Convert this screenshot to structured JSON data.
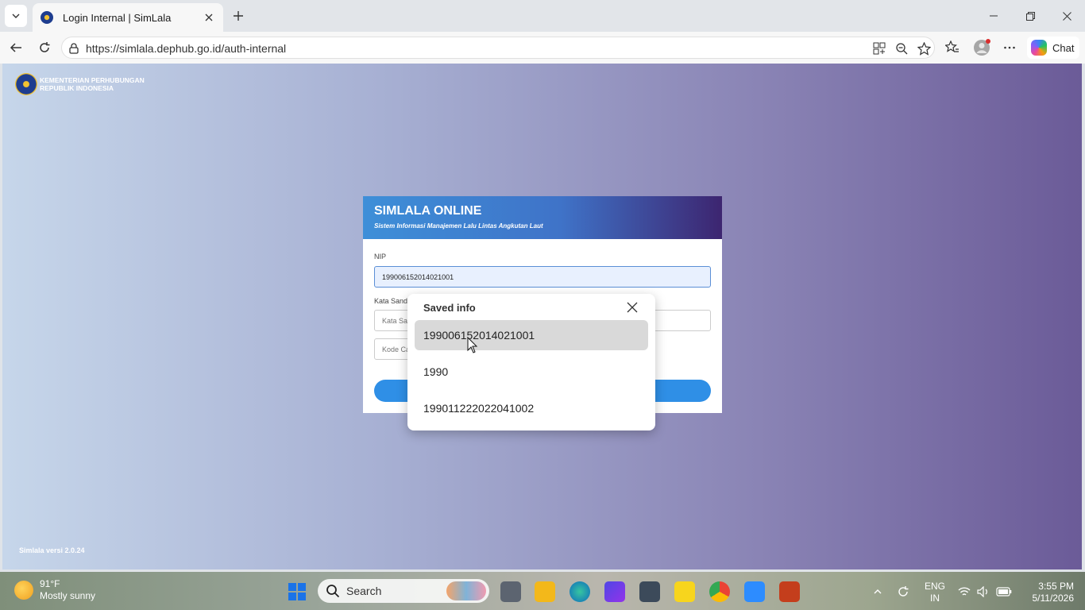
{
  "browser": {
    "tab_title": "Login Internal | SimLala",
    "url": "https://simlala.dephub.go.id/auth-internal",
    "chat_label": "Chat"
  },
  "page": {
    "brand_line1": "KEMENTERIAN PERHUBUNGAN",
    "brand_line2": "REPUBLIK INDONESIA",
    "version": "Simlala versi 2.0.24",
    "card_title": "SIMLALA ONLINE",
    "card_subtitle": "Sistem Informasi Manajemen Lalu Lintas Angkutan Laut",
    "nip_label": "NIP",
    "nip_value": "199006152014021001",
    "password_label": "Kata Sandi",
    "password_placeholder": "Kata Sandi",
    "captcha_placeholder": "Kode Captcha"
  },
  "autofill": {
    "title": "Saved info",
    "items": [
      "199006152014021001",
      "1990",
      "199011222022041002"
    ]
  },
  "taskbar": {
    "weather_temp": "91°F",
    "weather_cond": "Mostly sunny",
    "search_placeholder": "Search",
    "lang_line1": "ENG",
    "lang_line2": "IN",
    "time": "3:55 PM",
    "date": "5/11/2026"
  },
  "colors": {
    "accent": "#2f8fe6",
    "header_start": "#3e8fd8",
    "header_end": "#3d2570"
  }
}
